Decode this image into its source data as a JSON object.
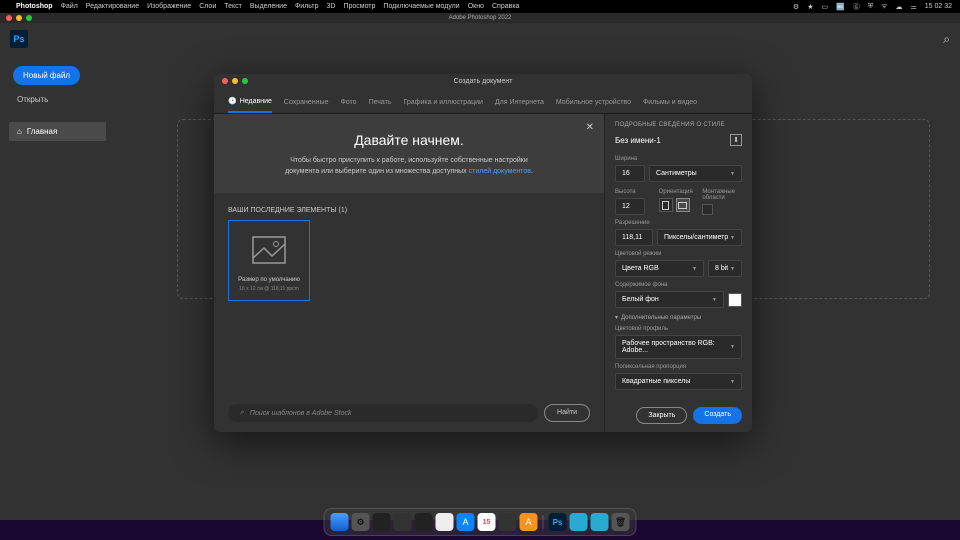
{
  "menubar": {
    "app": "Photoshop",
    "items": [
      "Файл",
      "Редактирование",
      "Изображение",
      "Слои",
      "Текст",
      "Выделение",
      "Фильтр",
      "3D",
      "Просмотр",
      "Подключаемые модули",
      "Окно",
      "Справка"
    ],
    "clock": "15 02 32",
    "date": "15"
  },
  "window_title": "Adobe Photoshop 2022",
  "ps_logo": "Ps",
  "sidebar": {
    "new_file": "Новый файл",
    "open": "Открыть",
    "home": "Главная"
  },
  "dialog": {
    "title": "Создать документ",
    "tabs": [
      "Недавние",
      "Сохраненные",
      "Фото",
      "Печать",
      "Графика и иллюстрации",
      "Для Интернета",
      "Мобильное устройство",
      "Фильмы и видео"
    ],
    "hero_title": "Давайте начнем.",
    "hero_text1": "Чтобы быстро приступить к работе, используйте собственные настройки",
    "hero_text2": "документа или выберите один из множества доступных ",
    "hero_link": "стилей документов",
    "recent_label": "ВАШИ ПОСЛЕДНИЕ ЭЛЕМЕНТЫ  (1)",
    "preset": {
      "name": "Размер по умолчанию",
      "dims": "16 x 12 см @ 118,11 ppcm"
    },
    "search_placeholder": "Поиск шаблонов в Adobe Stock",
    "find": "Найти",
    "details": {
      "header": "ПОДРОБНЫЕ СВЕДЕНИЯ О СТИЛЕ",
      "name": "Без имени-1",
      "width_label": "Ширина",
      "width_val": "16",
      "width_unit": "Сантиметры",
      "height_label": "Высота",
      "height_val": "12",
      "orient_label": "Ориентация",
      "artboards_label": "Монтажные области",
      "res_label": "Разрешение",
      "res_val": "118,11",
      "res_unit": "Пикселы/сантиметр",
      "color_label": "Цветовой режим",
      "color_val": "Цвета RGB",
      "bit_val": "8 bit",
      "bg_label": "Содержимое фона",
      "bg_val": "Белый фон",
      "advanced": "Дополнительные параметры",
      "profile_label": "Цветовой профиль",
      "profile_val": "Рабочее пространство RGB: Adobe...",
      "pixel_label": "Попиксельная пропорция",
      "pixel_val": "Квадратные пикселы",
      "close": "Закрыть",
      "create": "Создать"
    }
  }
}
